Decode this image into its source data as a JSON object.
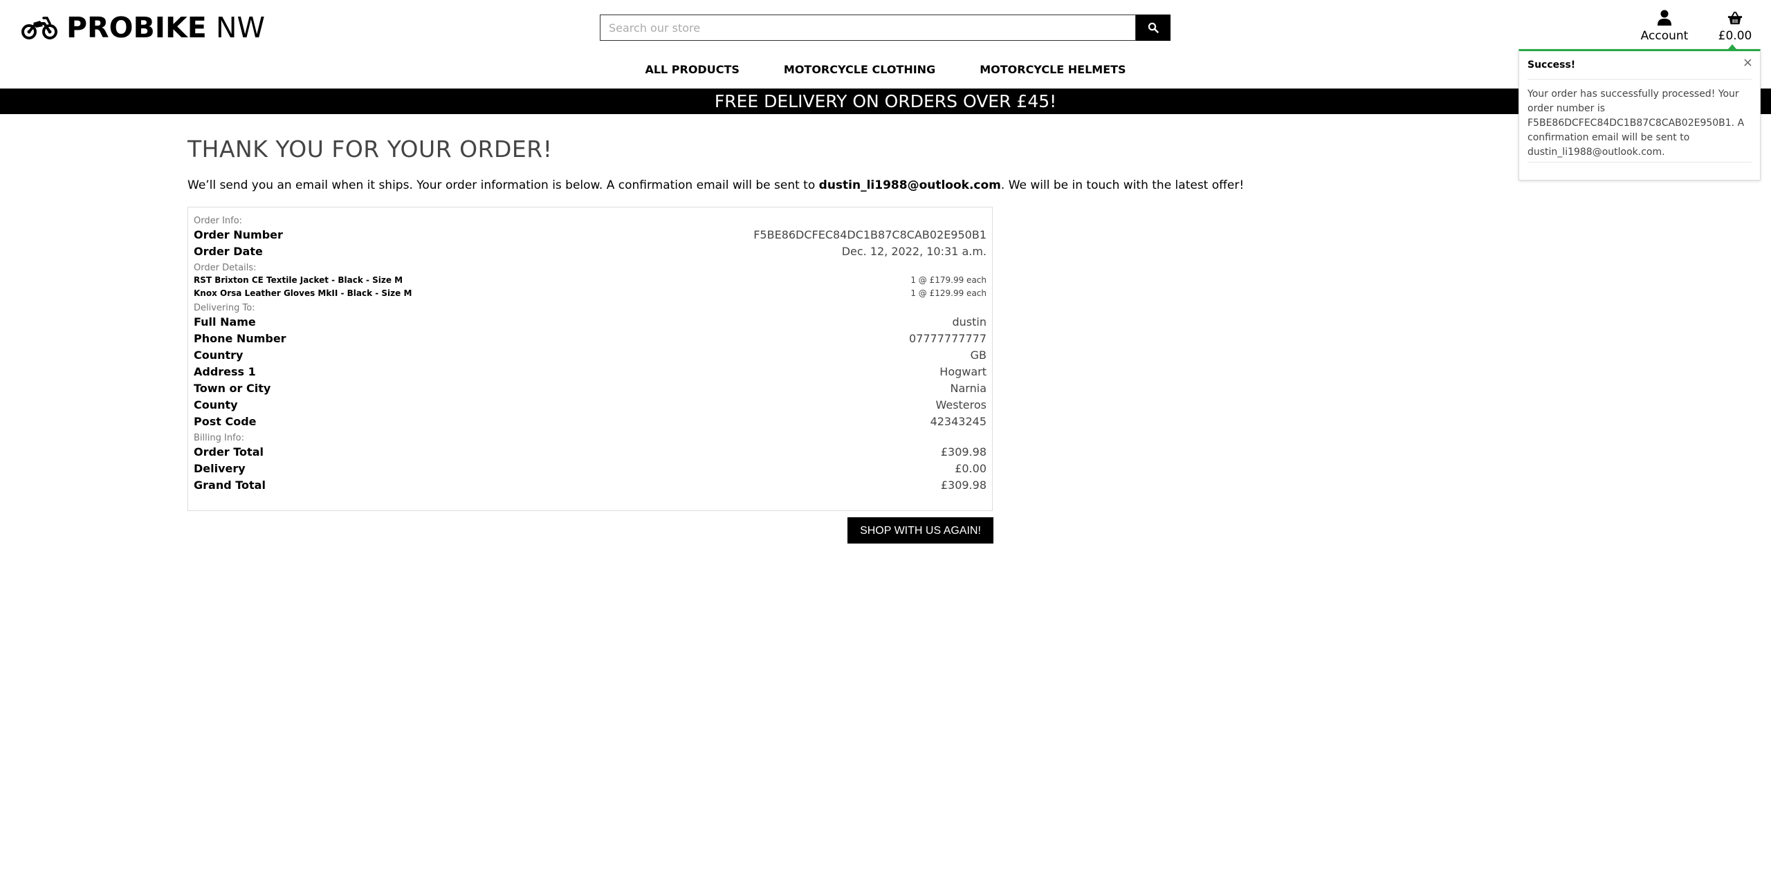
{
  "header": {
    "brand_bold": "PROBIKE",
    "brand_light": "NW",
    "search_placeholder": "Search our store",
    "account_label": "Account",
    "bag_total": "£0.00"
  },
  "nav": {
    "items": [
      "ALL PRODUCTS",
      "MOTORCYCLE CLOTHING",
      "MOTORCYCLE HELMETS"
    ]
  },
  "banner": {
    "text": "FREE DELIVERY ON ORDERS OVER £45!"
  },
  "main": {
    "title": "THANK YOU FOR YOUR ORDER!",
    "msg_before": "We’ll send you an email when it ships. Your order information is below. A confirmation email will be sent to ",
    "email": "dustin_li1988@outlook.com",
    "msg_after": ". We will be in touch with the latest offer!",
    "shop_again": "SHOP WITH US AGAIN!"
  },
  "order": {
    "info_heading": "Order Info:",
    "number_label": "Order Number",
    "number": "F5BE86DCFEC84DC1B87C8CAB02E950B1",
    "date_label": "Order Date",
    "date": "Dec. 12, 2022, 10:31 a.m.",
    "details_heading": "Order Details:",
    "items": [
      {
        "name": "RST Brixton CE Textile Jacket - Black - Size M",
        "qty_price": "1 @ £179.99 each"
      },
      {
        "name": "Knox Orsa Leather Gloves MkII - Black - Size M",
        "qty_price": "1 @ £129.99 each"
      }
    ],
    "delivery_heading": "Delivering To:",
    "delivery": [
      {
        "label": "Full Name",
        "value": "dustin"
      },
      {
        "label": "Phone Number",
        "value": "07777777777"
      },
      {
        "label": "Country",
        "value": "GB"
      },
      {
        "label": "Address 1",
        "value": "Hogwart"
      },
      {
        "label": "Town or City",
        "value": "Narnia"
      },
      {
        "label": "County",
        "value": "Westeros"
      },
      {
        "label": "Post Code",
        "value": "42343245"
      }
    ],
    "billing_heading": "Billing Info:",
    "billing": [
      {
        "label": "Order Total",
        "value": "£309.98"
      },
      {
        "label": "Delivery",
        "value": "£0.00"
      },
      {
        "label": "Grand Total",
        "value": "£309.98"
      }
    ]
  },
  "toast": {
    "title": "Success!",
    "close": "×",
    "message": "Your order has successfully processed! Your order number is F5BE86DCFEC84DC1B87C8CAB02E950B1. A confirmation email will be sent to dustin_li1988@outlook.com.",
    "accent_color": "#28a745"
  },
  "icons": {
    "logo": "motorcycle-icon",
    "search": "search-icon",
    "account": "user-icon",
    "bag": "shopping-basket-icon",
    "close": "close-icon"
  }
}
